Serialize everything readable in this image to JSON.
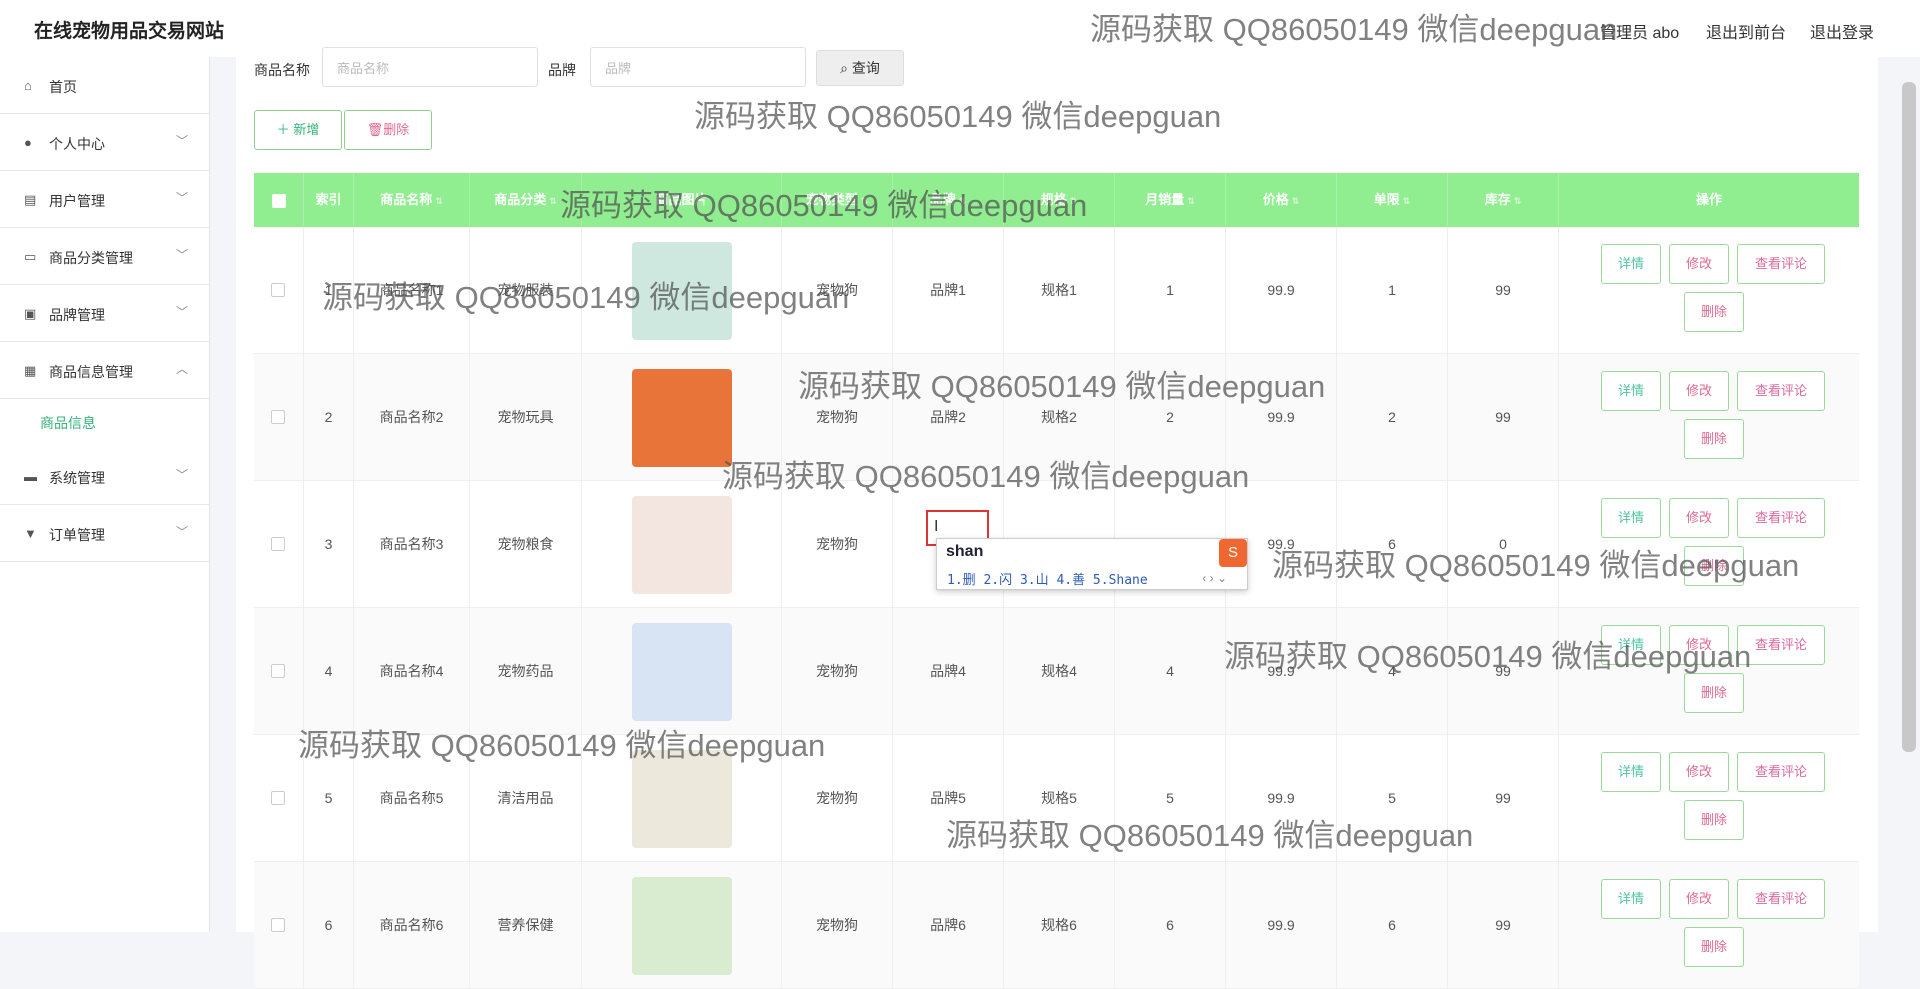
{
  "header": {
    "site_title": "在线宠物用品交易网站",
    "admin_label": "管理员 abo",
    "exit_front": "退出到前台",
    "logout": "退出登录"
  },
  "sidebar": {
    "items": [
      {
        "label": "首页",
        "icon": "home-icon"
      },
      {
        "label": "个人中心",
        "icon": "user-icon"
      },
      {
        "label": "用户管理",
        "icon": "clipboard-icon"
      },
      {
        "label": "商品分类管理",
        "icon": "card-icon"
      },
      {
        "label": "品牌管理",
        "icon": "tag-icon"
      },
      {
        "label": "商品信息管理",
        "icon": "grid-icon"
      },
      {
        "label": "系统管理",
        "icon": "monitor-icon"
      },
      {
        "label": "订单管理",
        "icon": "bell-icon"
      }
    ],
    "sub_item": "商品信息"
  },
  "search": {
    "name_label": "商品名称",
    "name_placeholder": "商品名称",
    "brand_label": "品牌",
    "brand_placeholder": "品牌",
    "query_label": "查询"
  },
  "actions": {
    "add_label": "新增",
    "delete_label": "删除"
  },
  "table": {
    "columns": [
      "索引",
      "商品名称",
      "商品分类",
      "商品图片",
      "宠物类型",
      "品牌",
      "规格",
      "月销量",
      "价格",
      "单限",
      "库存",
      "操作"
    ],
    "rows": [
      {
        "index": "1",
        "name": "商品名称1",
        "category": "宠物服装",
        "pet_type": "宠物狗",
        "brand": "品牌1",
        "spec": "规格1",
        "sales": "1",
        "price": "99.9",
        "limit": "1",
        "stock": "99"
      },
      {
        "index": "2",
        "name": "商品名称2",
        "category": "宠物玩具",
        "pet_type": "宠物狗",
        "brand": "品牌2",
        "spec": "规格2",
        "sales": "2",
        "price": "99.9",
        "limit": "2",
        "stock": "99"
      },
      {
        "index": "3",
        "name": "商品名称3",
        "category": "宠物粮食",
        "pet_type": "宠物狗",
        "brand": "",
        "spec": "",
        "sales": "",
        "price": "99.9",
        "limit": "6",
        "stock": "0"
      },
      {
        "index": "4",
        "name": "商品名称4",
        "category": "宠物药品",
        "pet_type": "宠物狗",
        "brand": "品牌4",
        "spec": "规格4",
        "sales": "4",
        "price": "99.9",
        "limit": "4",
        "stock": "99"
      },
      {
        "index": "5",
        "name": "商品名称5",
        "category": "清洁用品",
        "pet_type": "宠物狗",
        "brand": "品牌5",
        "spec": "规格5",
        "sales": "5",
        "price": "99.9",
        "limit": "5",
        "stock": "99"
      },
      {
        "index": "6",
        "name": "商品名称6",
        "category": "营养保健",
        "pet_type": "宠物狗",
        "brand": "品牌6",
        "spec": "规格6",
        "sales": "6",
        "price": "99.9",
        "limit": "6",
        "stock": "99"
      }
    ],
    "op_detail": "详情",
    "op_edit": "修改",
    "op_review": "查看评论",
    "op_delete": "删除"
  },
  "ime": {
    "input": "shan",
    "candidates": "1.删 2.闪 3.山 4.善 5.Shane"
  },
  "watermark": "源码获取 QQ86050149 微信deepguan",
  "colors": {
    "header_green": "#90ee90",
    "accent_green": "#35b37b",
    "delete_pink": "#e06a8c"
  }
}
